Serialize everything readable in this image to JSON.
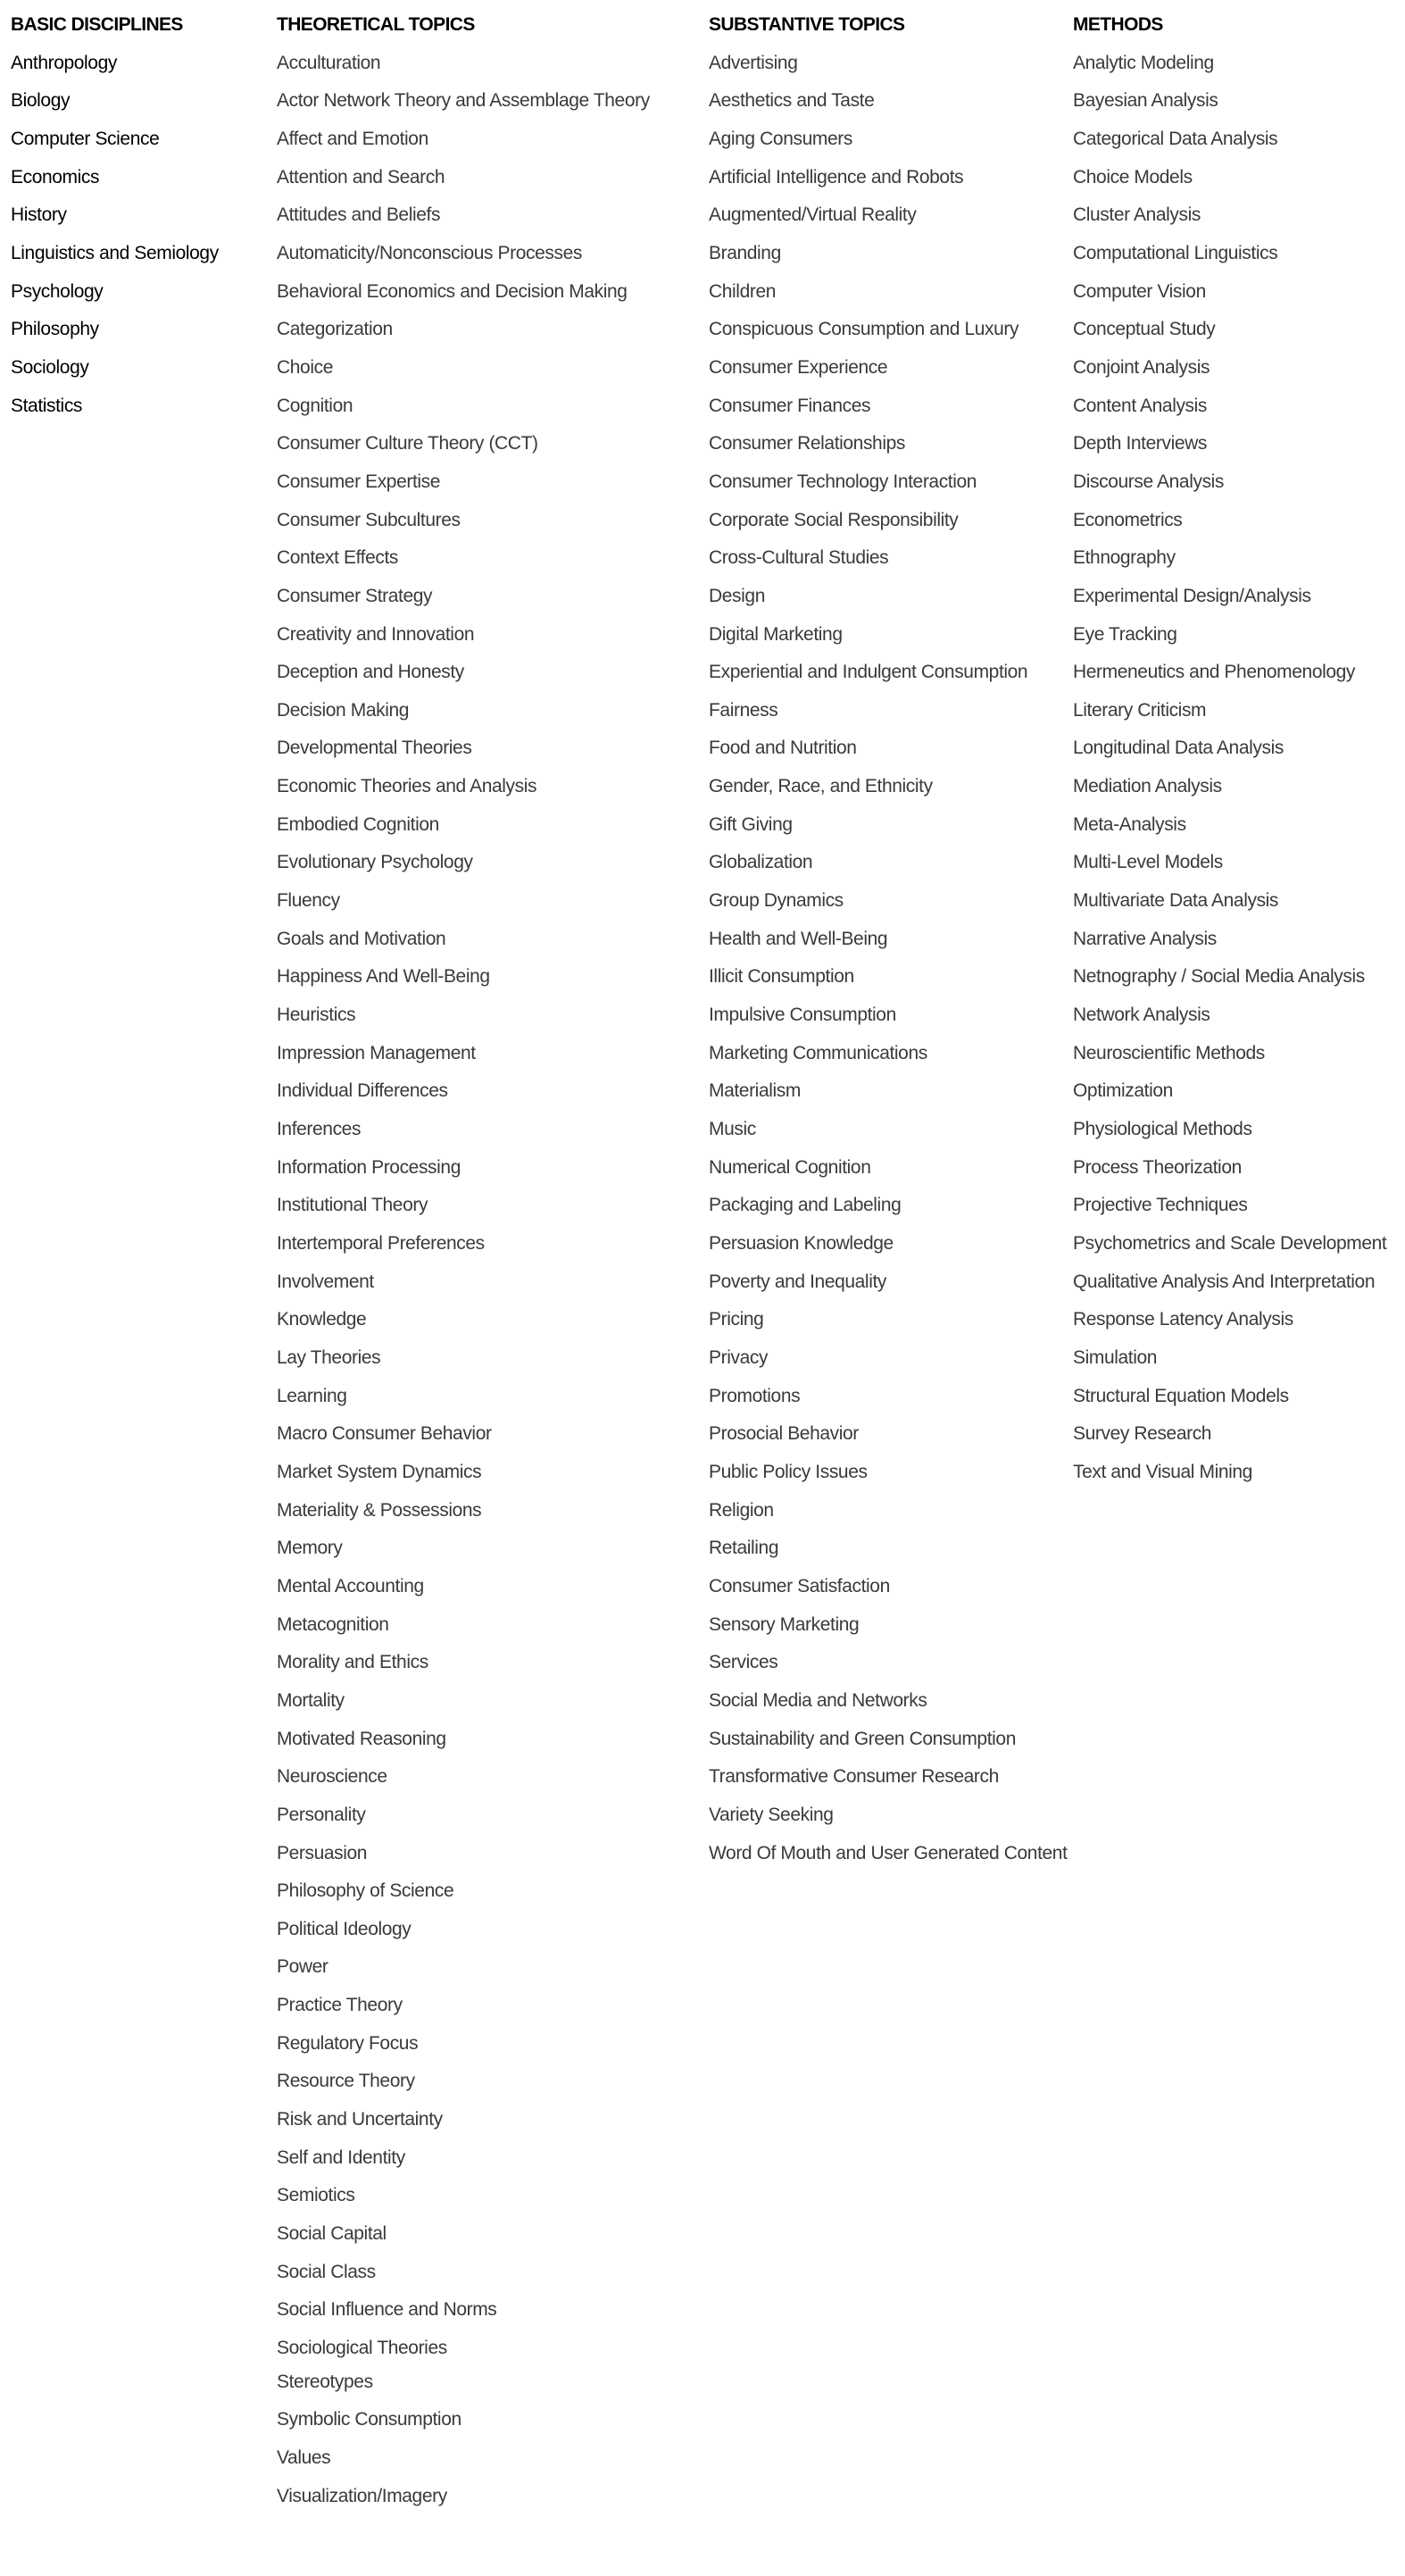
{
  "columns": [
    {
      "header": "BASIC DISCIPLINES",
      "items": [
        "Anthropology",
        "Biology",
        "Computer Science",
        "Economics",
        "History",
        "Linguistics and Semiology",
        "Psychology",
        "Philosophy",
        "Sociology",
        "Statistics"
      ]
    },
    {
      "header": "THEORETICAL TOPICS",
      "items": [
        "Acculturation",
        "Actor Network Theory and Assemblage Theory",
        "Affect and Emotion",
        "Attention and Search",
        "Attitudes and Beliefs",
        "Automaticity/Nonconscious Processes",
        "Behavioral Economics and Decision Making",
        "Categorization",
        "Choice",
        "Cognition",
        "Consumer Culture Theory (CCT)",
        "Consumer Expertise",
        "Consumer Subcultures",
        "Context Effects",
        "Consumer Strategy",
        "Creativity and Innovation",
        "Deception and Honesty",
        "Decision Making",
        "Developmental Theories",
        "Economic Theories and Analysis",
        "Embodied Cognition",
        "Evolutionary Psychology",
        "Fluency",
        "Goals and Motivation",
        "Happiness And Well-Being",
        "Heuristics",
        "Impression Management",
        "Individual Differences",
        "Inferences",
        "Information Processing",
        "Institutional Theory",
        "Intertemporal Preferences",
        "Involvement",
        "Knowledge",
        "Lay Theories",
        "Learning",
        "Macro Consumer Behavior",
        "Market System Dynamics",
        "Materiality & Possessions",
        "Memory",
        "Mental Accounting",
        "Metacognition",
        "Morality and Ethics",
        "Mortality",
        "Motivated Reasoning",
        "Neuroscience",
        "Personality",
        "Persuasion",
        "Philosophy of Science",
        "Political Ideology",
        "Power",
        "Practice Theory",
        "Regulatory Focus",
        "Resource Theory",
        "Risk and Uncertainty",
        "Self and Identity",
        "Semiotics",
        "Social Capital",
        "Social Class",
        "Social Influence and Norms",
        "Sociological Theories",
        "Stereotypes",
        "Symbolic Consumption",
        "Values",
        "Visualization/Imagery"
      ]
    },
    {
      "header": "SUBSTANTIVE TOPICS",
      "items": [
        "Advertising",
        "Aesthetics and Taste",
        "Aging Consumers",
        "Artificial Intelligence and Robots",
        "Augmented/Virtual Reality",
        "Branding",
        "Children",
        "Conspicuous Consumption and Luxury",
        "Consumer Experience",
        "Consumer Finances",
        "Consumer Relationships",
        "Consumer Technology Interaction",
        "Corporate Social Responsibility",
        "Cross-Cultural Studies",
        "Design",
        "Digital Marketing",
        "Experiential and Indulgent Consumption",
        "Fairness",
        "Food and Nutrition",
        "Gender, Race, and Ethnicity",
        "Gift Giving",
        "Globalization",
        "Group Dynamics",
        "Health and Well-Being",
        "Illicit Consumption",
        "Impulsive Consumption",
        "Marketing Communications",
        "Materialism",
        "Music",
        "Numerical Cognition",
        "Packaging and Labeling",
        "Persuasion Knowledge",
        "Poverty and Inequality",
        "Pricing",
        "Privacy",
        "Promotions",
        "Prosocial Behavior",
        "Public Policy Issues",
        "Religion",
        "Retailing",
        "Consumer Satisfaction",
        "Sensory Marketing",
        "Services",
        "Social Media and Networks",
        "Sustainability and Green Consumption",
        "Transformative Consumer Research",
        "Variety Seeking",
        "Word Of Mouth and User Generated Content"
      ]
    },
    {
      "header": "METHODS",
      "items": [
        "Analytic Modeling",
        "Bayesian Analysis",
        "Categorical Data Analysis",
        "Choice Models",
        "Cluster Analysis",
        "Computational Linguistics",
        "Computer Vision",
        "Conceptual Study",
        "Conjoint Analysis",
        "Content Analysis",
        "Depth Interviews",
        "Discourse Analysis",
        "Econometrics",
        "Ethnography",
        "Experimental Design/Analysis",
        "Eye Tracking",
        "Hermeneutics and Phenomenology",
        "Literary Criticism",
        "Longitudinal Data Analysis",
        "Mediation Analysis",
        "Meta-Analysis",
        "Multi-Level Models",
        "Multivariate Data Analysis",
        "Narrative Analysis",
        "Netnography / Social Media Analysis",
        "Network Analysis",
        "Neuroscientific Methods",
        "Optimization",
        "Physiological Methods",
        "Process Theorization",
        "Projective Techniques",
        "Psychometrics and Scale Development",
        "Qualitative Analysis And Interpretation",
        "Response Latency Analysis",
        "Simulation",
        "Structural Equation Models",
        "Survey Research",
        "Text and Visual Mining"
      ]
    }
  ]
}
